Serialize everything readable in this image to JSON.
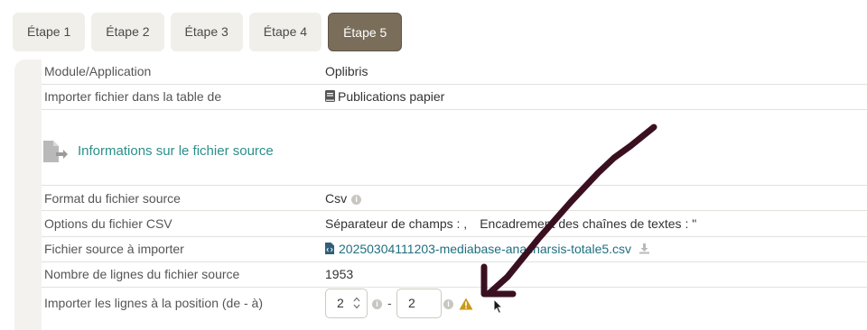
{
  "tabs": [
    "Étape 1",
    "Étape 2",
    "Étape 3",
    "Étape 4",
    "Étape 5"
  ],
  "rows": {
    "module": {
      "label": "Module/Application",
      "value": "Oplibris"
    },
    "table": {
      "label": "Importer fichier dans la table de",
      "value": "Publications papier"
    },
    "section_title": "Informations sur le fichier source",
    "format": {
      "label": "Format du fichier source",
      "value": "Csv"
    },
    "csv_options": {
      "label": "Options du fichier CSV",
      "separator": "Séparateur de champs : ,",
      "enclosure": "Encadrement des chaînes de textes : \""
    },
    "source_file": {
      "label": "Fichier source à importer",
      "value": "20250304111203-mediabase-anacharsis-totale5.csv"
    },
    "line_count": {
      "label": "Nombre de lignes du fichier source",
      "value": "1953"
    },
    "position": {
      "label": "Importer les lignes à la position (de - à)",
      "from": "2",
      "separator": "-",
      "to": "2"
    }
  },
  "colors": {
    "active_tab": "#7a6d5a",
    "link": "#1f6f80",
    "section": "#2b8f8a",
    "warning": "#c79a1a",
    "arrow": "#3a1020"
  }
}
